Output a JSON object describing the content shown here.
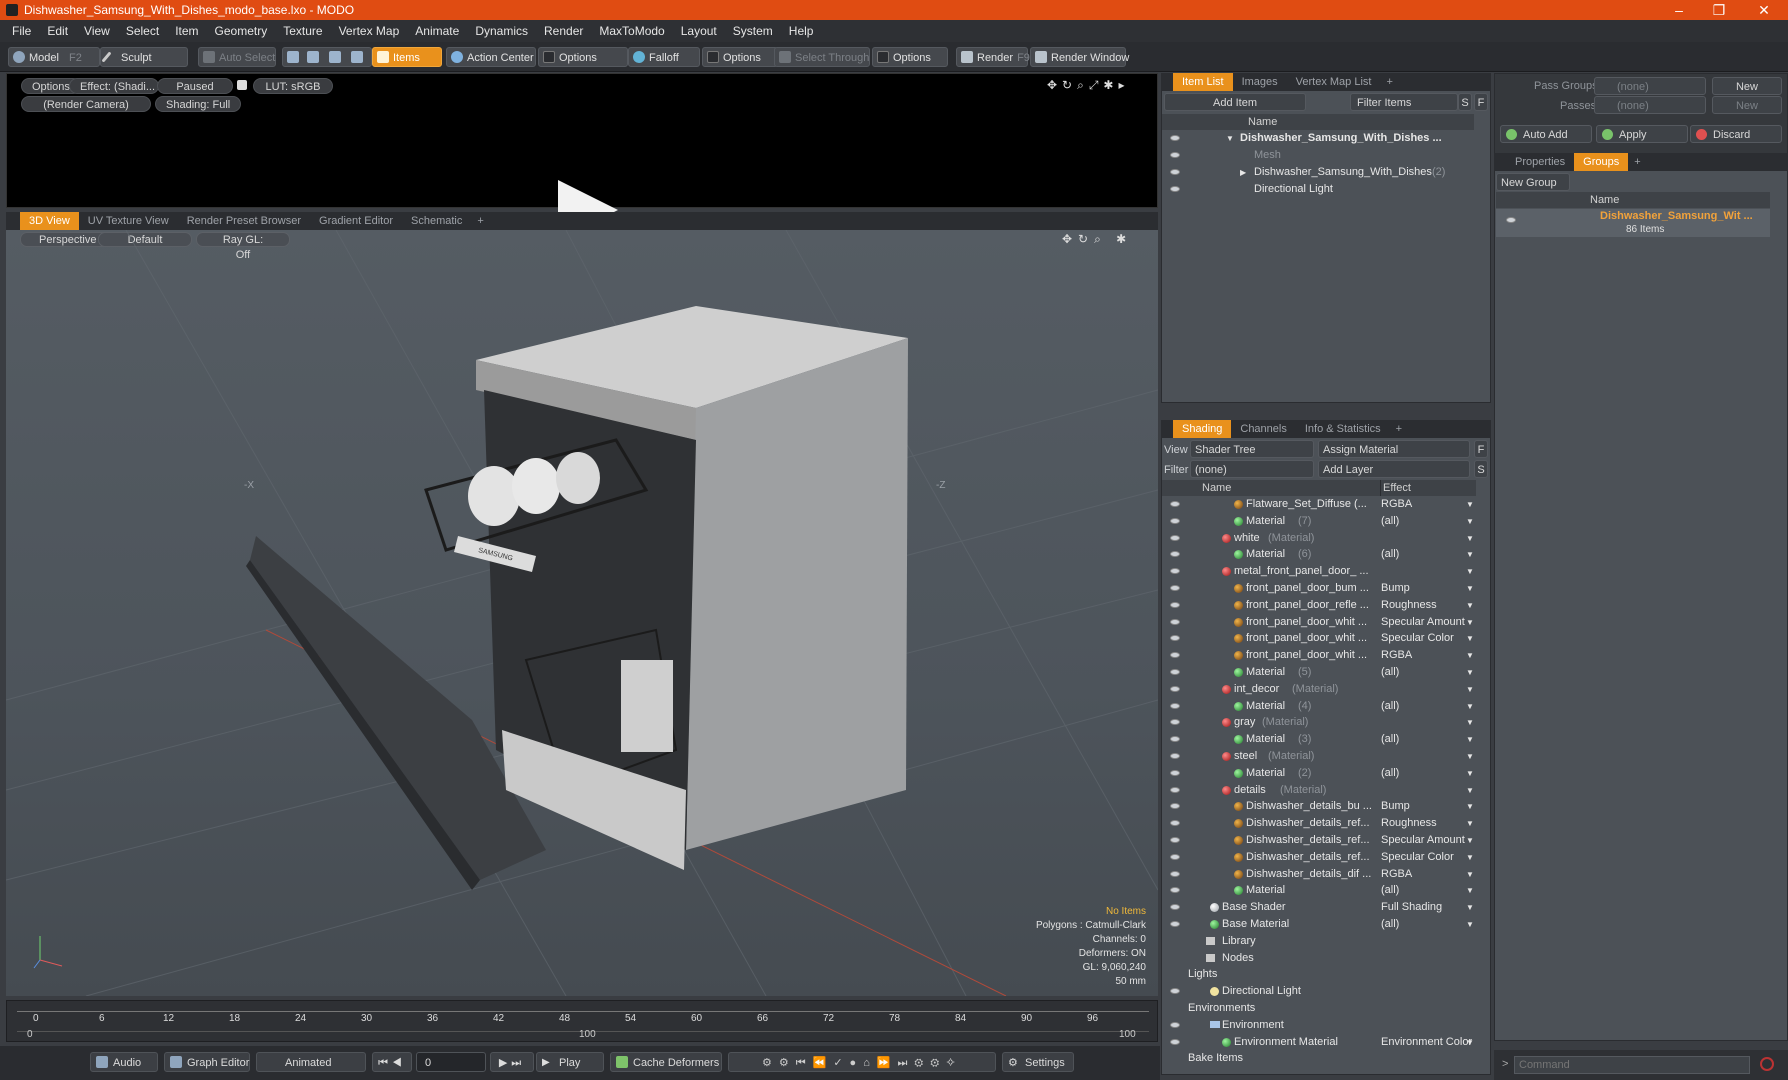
{
  "window": {
    "title": "Dishwasher_Samsung_With_Dishes_modo_base.lxo - MODO",
    "minimize": "–",
    "maximize": "❐",
    "close": "✕"
  },
  "menu": [
    "File",
    "Edit",
    "View",
    "Select",
    "Item",
    "Geometry",
    "Texture",
    "Vertex Map",
    "Animate",
    "Dynamics",
    "Render",
    "MaxToModo",
    "Layout",
    "System",
    "Help"
  ],
  "toolbar": {
    "model": "Model",
    "model_key": "F2",
    "sculpt": "Sculpt",
    "auto_select": "Auto Select",
    "items": "Items",
    "action_center": "Action Center",
    "options1": "Options",
    "falloff": "Falloff",
    "options2": "Options",
    "select_through": "Select Through",
    "options3": "Options",
    "render": "Render",
    "render_key": "F9",
    "render_window": "Render Window"
  },
  "render_preview": {
    "options": "Options",
    "effect": "Effect: (Shadi...",
    "paused": "Paused",
    "lut": "LUT: sRGB",
    "camera": "(Render Camera)",
    "shading": "Shading: Full"
  },
  "view_tabs": [
    "3D View",
    "UV Texture View",
    "Render Preset Browser",
    "Gradient Editor",
    "Schematic",
    "+"
  ],
  "viewport": {
    "projection": "Perspective",
    "style": "Default",
    "raygl": "Ray GL: Off",
    "axis_x_label": "-X",
    "axis_z_label": "-Z",
    "hud": {
      "selection": "No Items",
      "polygons": "Polygons : Catmull-Clark",
      "channels": "Channels: 0",
      "deformers": "Deformers: ON",
      "gl": "GL: 9,060,240",
      "focal": "50 mm"
    },
    "brand_text": "SAMSUNG"
  },
  "timeline": {
    "ticks": [
      "0",
      "6",
      "12",
      "18",
      "24",
      "30",
      "36",
      "42",
      "48",
      "54",
      "60",
      "66",
      "72",
      "78",
      "84",
      "90",
      "96"
    ],
    "start": "0",
    "mid": "100",
    "end": "100"
  },
  "bottombar": {
    "audio": "Audio",
    "graph_editor": "Graph Editor",
    "animated": "Animated",
    "frame": "0",
    "play": "Play",
    "cache_deformers": "Cache Deformers",
    "settings": "Settings"
  },
  "item_list": {
    "tabs": [
      "Item List",
      "Images",
      "Vertex Map List",
      "+"
    ],
    "add_item": "Add Item",
    "filter_items": "Filter Items",
    "s": "S",
    "f": "F",
    "col_name": "Name",
    "rows": [
      {
        "label": "Dishwasher_Samsung_With_Dishes ...",
        "indent": 0,
        "bold": true,
        "expand": "▼"
      },
      {
        "label": "Mesh",
        "indent": 1,
        "dim": true
      },
      {
        "label": "Dishwasher_Samsung_With_Dishes",
        "count": "(2)",
        "indent": 1,
        "expand": "▶"
      },
      {
        "label": "Directional Light",
        "indent": 1
      }
    ]
  },
  "shading": {
    "tabs": [
      "Shading",
      "Channels",
      "Info & Statistics",
      "+"
    ],
    "view_label": "View",
    "view_value": "Shader Tree",
    "assign_material": "Assign Material",
    "f": "F",
    "filter_label": "Filter",
    "filter_value": "(none)",
    "add_layer": "Add Layer",
    "s": "S",
    "col_name": "Name",
    "col_effect": "Effect",
    "rows": [
      {
        "label": "Flatware_Set_Diffuse (...",
        "effect": "RGBA",
        "type": "tex",
        "indent": 3
      },
      {
        "label": "Material",
        "suffix": "(7)",
        "effect": "(all)",
        "type": "mat",
        "indent": 3
      },
      {
        "label": "white",
        "suffix": "(Material)",
        "effect": "",
        "type": "grp",
        "indent": 2
      },
      {
        "label": "Material",
        "suffix": "(6)",
        "effect": "(all)",
        "type": "mat",
        "indent": 3
      },
      {
        "label": "metal_front_panel_door_ ...",
        "suffix": "",
        "effect": "",
        "type": "grp",
        "indent": 2
      },
      {
        "label": "front_panel_door_bum ...",
        "effect": "Bump",
        "type": "tex",
        "indent": 3
      },
      {
        "label": "front_panel_door_refle ...",
        "effect": "Roughness",
        "type": "tex",
        "indent": 3
      },
      {
        "label": "front_panel_door_whit ...",
        "effect": "Specular Amount",
        "type": "tex",
        "indent": 3
      },
      {
        "label": "front_panel_door_whit ...",
        "effect": "Specular Color",
        "type": "tex",
        "indent": 3
      },
      {
        "label": "front_panel_door_whit ...",
        "effect": "RGBA",
        "type": "tex",
        "indent": 3
      },
      {
        "label": "Material",
        "suffix": "(5)",
        "effect": "(all)",
        "type": "mat",
        "indent": 3
      },
      {
        "label": "int_decor",
        "suffix": "(Material)",
        "effect": "",
        "type": "grp",
        "indent": 2
      },
      {
        "label": "Material",
        "suffix": "(4)",
        "effect": "(all)",
        "type": "mat",
        "indent": 3
      },
      {
        "label": "gray",
        "suffix": "(Material)",
        "effect": "",
        "type": "grp",
        "indent": 2
      },
      {
        "label": "Material",
        "suffix": "(3)",
        "effect": "(all)",
        "type": "mat",
        "indent": 3
      },
      {
        "label": "steel",
        "suffix": "(Material)",
        "effect": "",
        "type": "grp",
        "indent": 2
      },
      {
        "label": "Material",
        "suffix": "(2)",
        "effect": "(all)",
        "type": "mat",
        "indent": 3
      },
      {
        "label": "details",
        "suffix": "(Material)",
        "effect": "",
        "type": "grp",
        "indent": 2
      },
      {
        "label": "Dishwasher_details_bu ...",
        "effect": "Bump",
        "type": "tex",
        "indent": 3
      },
      {
        "label": "Dishwasher_details_ref...",
        "effect": "Roughness",
        "type": "tex",
        "indent": 3
      },
      {
        "label": "Dishwasher_details_ref...",
        "effect": "Specular Amount",
        "type": "tex",
        "indent": 3
      },
      {
        "label": "Dishwasher_details_ref...",
        "effect": "Specular Color",
        "type": "tex",
        "indent": 3
      },
      {
        "label": "Dishwasher_details_dif ...",
        "effect": "RGBA",
        "type": "tex",
        "indent": 3
      },
      {
        "label": "Material",
        "suffix": "",
        "effect": "(all)",
        "type": "mat",
        "indent": 3
      },
      {
        "label": "Base Shader",
        "effect": "Full Shading",
        "type": "sh",
        "indent": 1
      },
      {
        "label": "Base Material",
        "effect": "(all)",
        "type": "mat",
        "indent": 1
      },
      {
        "label": "Library",
        "effect": "",
        "type": "folder",
        "indent": 1
      },
      {
        "label": "Nodes",
        "effect": "",
        "type": "folder",
        "indent": 1
      },
      {
        "label": "Lights",
        "effect": "",
        "type": "none",
        "indent": 0
      },
      {
        "label": "Directional Light",
        "effect": "",
        "type": "light",
        "indent": 1
      },
      {
        "label": "Environments",
        "effect": "",
        "type": "none",
        "indent": 0
      },
      {
        "label": "Environment",
        "effect": "",
        "type": "env",
        "indent": 1
      },
      {
        "label": "Environment Material",
        "effect": "Environment Color",
        "type": "mat",
        "indent": 2
      },
      {
        "label": "Bake Items",
        "effect": "",
        "type": "none",
        "indent": 0
      }
    ]
  },
  "groups_panel": {
    "pass_groups_label": "Pass Groups",
    "pass_groups_value": "(none)",
    "new1": "New",
    "passes_label": "Passes",
    "passes_value": "(none)",
    "new2": "New",
    "auto_add": "Auto Add",
    "apply": "Apply",
    "discard": "Discard",
    "tabs": [
      "Properties",
      "Groups",
      "+"
    ],
    "new_group": "New Group",
    "col_name": "Name",
    "group_name": "Dishwasher_Samsung_Wit ...",
    "group_count": "86 Items",
    "command_placeholder": "Command"
  },
  "colors": {
    "accent": "#e9911c",
    "title_bar": "#e04c12",
    "group_name": "#f2a23a"
  }
}
